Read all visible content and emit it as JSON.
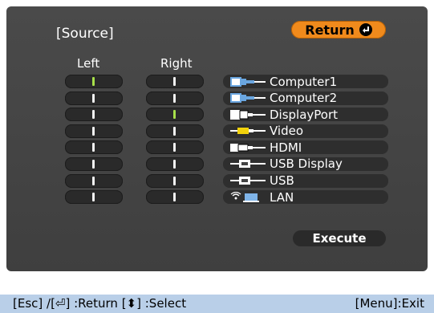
{
  "header": {
    "title": "[Source]",
    "return_label": "Return"
  },
  "columns": {
    "left_label": "Left",
    "right_label": "Right"
  },
  "left_marks": [
    true,
    false,
    false,
    false,
    false,
    false,
    false,
    false
  ],
  "right_marks": [
    false,
    false,
    true,
    false,
    false,
    false,
    false,
    false
  ],
  "sources": [
    {
      "label": "Computer1",
      "icon": "vga-cable-icon"
    },
    {
      "label": "Computer2",
      "icon": "vga-cable-icon"
    },
    {
      "label": "DisplayPort",
      "icon": "displayport-cable-icon"
    },
    {
      "label": "Video",
      "icon": "composite-video-cable-icon"
    },
    {
      "label": "HDMI",
      "icon": "hdmi-cable-icon"
    },
    {
      "label": "USB Display",
      "icon": "usb-cable-icon"
    },
    {
      "label": "USB",
      "icon": "usb-cable-icon"
    },
    {
      "label": "LAN",
      "icon": "wireless-lan-icon"
    }
  ],
  "execute_label": "Execute",
  "footer": {
    "left": "[Esc] /[⏎] :Return  [⬍] :Select",
    "right": "[Menu]:Exit"
  },
  "colors": {
    "accent": "#f08a1c",
    "active_mark": "#a7e04a",
    "panel": "#444444",
    "footer": "#b9cfe8"
  }
}
